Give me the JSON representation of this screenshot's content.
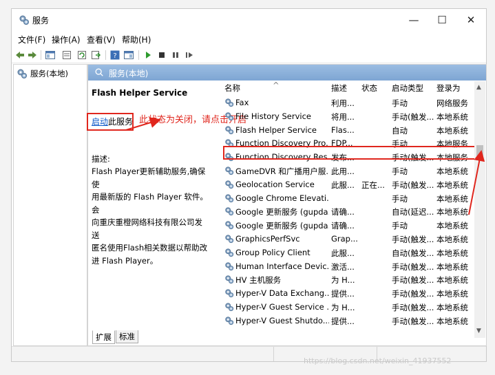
{
  "window": {
    "title": "服务",
    "minimize": "—",
    "maximize": "☐",
    "close": "✕"
  },
  "menu": [
    "文件(F)",
    "操作(A)",
    "查看(V)",
    "帮助(H)"
  ],
  "tree": {
    "root": "服务(本地)"
  },
  "panel": {
    "header": "服务(本地)"
  },
  "detail": {
    "service_name": "Flash Helper Service",
    "start_link": "启动",
    "start_suffix": "此服务",
    "annotation": "此状态为关闭，请点击开启",
    "desc_label": "描述:",
    "desc_lines": [
      "Flash Player更新辅助服务,确保使",
      "用最新版的 Flash Player 软件。会",
      "向重庆重橙网络科技有限公司发送",
      "匿名使用Flash相关数据以帮助改",
      "进 Flash Player。"
    ]
  },
  "columns": [
    "名称",
    "描述",
    "状态",
    "启动类型",
    "登录为"
  ],
  "sort_indicator": "^",
  "rows": [
    {
      "name": "Fax",
      "desc": "利用...",
      "status": "",
      "startup": "手动",
      "logon": "网络服务"
    },
    {
      "name": "File History Service",
      "desc": "将用...",
      "status": "",
      "startup": "手动(触发...",
      "logon": "本地系统"
    },
    {
      "name": "Flash Helper Service",
      "desc": "Flas...",
      "status": "",
      "startup": "自动",
      "logon": "本地系统"
    },
    {
      "name": "Function Discovery Pro...",
      "desc": "FDP...",
      "status": "",
      "startup": "手动",
      "logon": "本地服务"
    },
    {
      "name": "Function Discovery Res...",
      "desc": "发布...",
      "status": "",
      "startup": "手动(触发...",
      "logon": "本地服务"
    },
    {
      "name": "GameDVR 和广播用户服...",
      "desc": "此用...",
      "status": "",
      "startup": "手动",
      "logon": "本地系统"
    },
    {
      "name": "Geolocation Service",
      "desc": "此服...",
      "status": "正在...",
      "startup": "手动(触发...",
      "logon": "本地系统"
    },
    {
      "name": "Google Chrome Elevati...",
      "desc": "",
      "status": "",
      "startup": "手动",
      "logon": "本地系统"
    },
    {
      "name": "Google 更新服务 (gupda...",
      "desc": "请确...",
      "status": "",
      "startup": "自动(延迟...",
      "logon": "本地系统"
    },
    {
      "name": "Google 更新服务 (gupda...",
      "desc": "请确...",
      "status": "",
      "startup": "手动",
      "logon": "本地系统"
    },
    {
      "name": "GraphicsPerfSvc",
      "desc": "Grap...",
      "status": "",
      "startup": "手动(触发...",
      "logon": "本地系统"
    },
    {
      "name": "Group Policy Client",
      "desc": "此服...",
      "status": "",
      "startup": "自动(触发...",
      "logon": "本地系统"
    },
    {
      "name": "Human Interface Devic...",
      "desc": "激活...",
      "status": "",
      "startup": "手动(触发...",
      "logon": "本地系统"
    },
    {
      "name": "HV 主机服务",
      "desc": "为 H...",
      "status": "",
      "startup": "手动(触发...",
      "logon": "本地系统"
    },
    {
      "name": "Hyper-V Data Exchang...",
      "desc": "提供...",
      "status": "",
      "startup": "手动(触发...",
      "logon": "本地系统"
    },
    {
      "name": "Hyper-V Guest Service ...",
      "desc": "为 H...",
      "status": "",
      "startup": "手动(触发...",
      "logon": "本地系统"
    },
    {
      "name": "Hyper-V Guest Shutdo...",
      "desc": "提供...",
      "status": "",
      "startup": "手动(触发...",
      "logon": "本地系统"
    }
  ],
  "tabs": [
    "扩展",
    "标准"
  ],
  "watermark": "https://blog.csdn.net/weixin_41937552",
  "colors": {
    "accent_red": "#e0261d",
    "header_blue": "#8cb1db",
    "link_blue": "#0a57c9"
  }
}
